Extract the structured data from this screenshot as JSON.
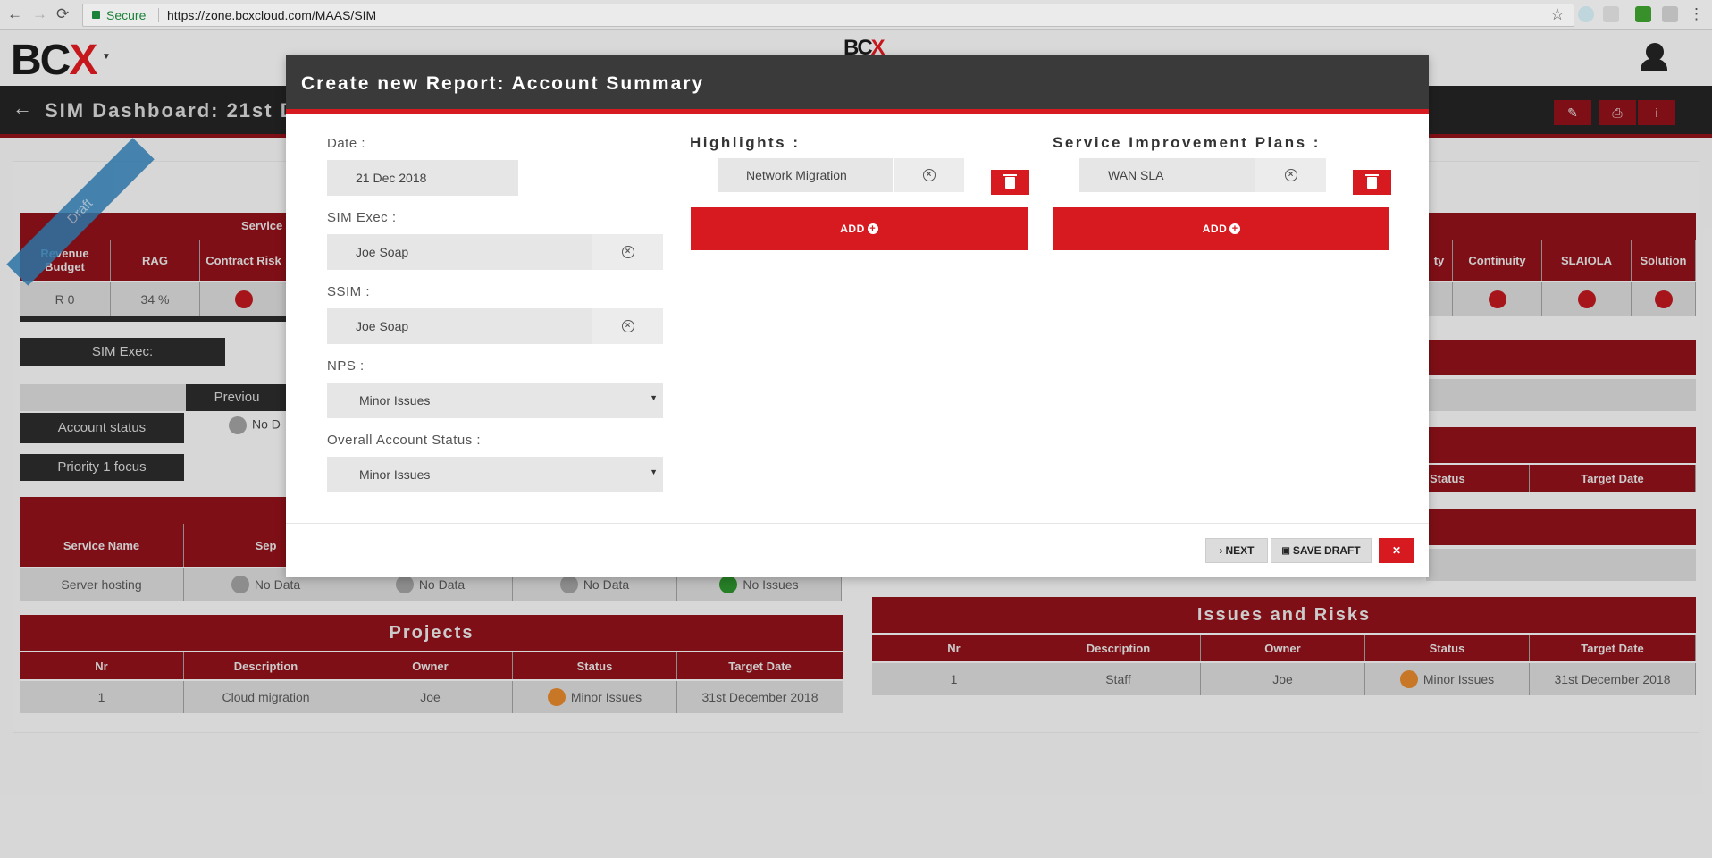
{
  "browser": {
    "back": "←",
    "forward": "→",
    "reload": "⟳",
    "secure": "Secure",
    "url": "https://zone.bcxcloud.com/MAAS/SIM"
  },
  "header": {
    "logo_main": "BC",
    "logo_accent": "X",
    "center_logo_main": "BC",
    "center_logo_accent": "X"
  },
  "titlebar": {
    "title": "SIM Dashboard: 21st De"
  },
  "background": {
    "ribbon": "Draft",
    "service_header": "Service",
    "left_cols": [
      "Revenue Budget",
      "RAG",
      "Contract Risk"
    ],
    "left_vals": [
      "R 0",
      "34 %"
    ],
    "right_cols": [
      "ty",
      "Continuity",
      "SLAIOLA",
      "Solution"
    ],
    "sim_exec_label": "SIM Exec:",
    "previous_label": "Previou",
    "account_status": "Account status",
    "no_data_short": "No D",
    "priority": "Priority 1 focus",
    "services_header": [
      "Service Name",
      "Sep"
    ],
    "server_hosting": "Server hosting",
    "no_data": "No Data",
    "no_issues": "No Issues",
    "right_status_cols": [
      "Status",
      "Target Date"
    ],
    "projects": {
      "title": "Projects",
      "cols": [
        "Nr",
        "Description",
        "Owner",
        "Status",
        "Target Date"
      ],
      "row": [
        "1",
        "Cloud migration",
        "Joe",
        "Minor Issues",
        "31st December 2018"
      ]
    },
    "issues": {
      "title": "Issues and Risks",
      "cols": [
        "Nr",
        "Description",
        "Owner",
        "Status",
        "Target Date"
      ],
      "row": [
        "1",
        "Staff",
        "Joe",
        "Minor Issues",
        "31st December 2018"
      ]
    }
  },
  "modal": {
    "title": "Create new Report: Account Summary",
    "date_label": "Date :",
    "date_value": "21 Dec 2018",
    "sim_exec_label": "SIM Exec :",
    "sim_exec_value": "Joe Soap",
    "ssim_label": "SSIM :",
    "ssim_value": "Joe Soap",
    "nps_label": "NPS :",
    "nps_value": "Minor Issues",
    "overall_label": "Overall Account Status :",
    "overall_value": "Minor Issues",
    "highlights_label": "Highlights :",
    "highlight_item": "Network Migration",
    "sip_label": "Service Improvement Plans :",
    "sip_item": "WAN SLA",
    "add_label": "ADD",
    "next_label": "NEXT",
    "save_label": "SAVE DRAFT",
    "close_label": "✕"
  }
}
